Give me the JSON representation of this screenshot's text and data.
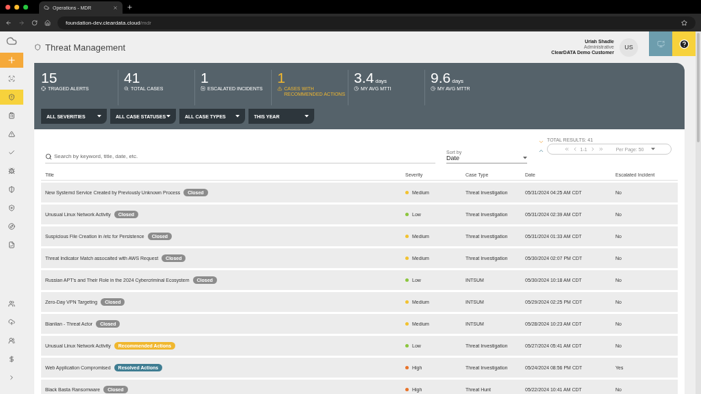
{
  "browser": {
    "tab_title": "Operations - MDR",
    "url_host": "foundation-dev.cleardata.cloud",
    "url_path": "/mdr"
  },
  "header": {
    "title": "Threat Management",
    "user_name": "Uriah Shadle",
    "user_role": "Administrative",
    "user_org": "ClearDATA Demo Customer",
    "avatar": "US"
  },
  "sidebar": {
    "items": [
      {
        "selected": false
      },
      {
        "selected": false
      },
      {
        "selected": true
      },
      {
        "selected": false
      },
      {
        "selected": false
      },
      {
        "selected": false
      },
      {
        "selected": false
      },
      {
        "selected": false
      },
      {
        "selected": false
      },
      {
        "selected": false
      },
      {
        "selected": false
      }
    ]
  },
  "stats": [
    {
      "value": "15",
      "label": "TRIAGED ALERTS",
      "highlight": false
    },
    {
      "value": "41",
      "label": "TOTAL CASES",
      "highlight": false
    },
    {
      "value": "1",
      "label": "ESCALATED INCIDENTS",
      "highlight": false
    },
    {
      "value": "1",
      "label": "CASES WITH RECOMMENDED ACTIONS",
      "highlight": true
    },
    {
      "value": "3.4",
      "unit": "days",
      "label": "MY AVG MTTI",
      "highlight": false
    },
    {
      "value": "9.6",
      "unit": "days",
      "label": "MY AVG MTTR",
      "highlight": false
    }
  ],
  "filters": [
    "ALL SEVERITIES",
    "ALL CASE STATUSES",
    "ALL CASE TYPES",
    "THIS YEAR"
  ],
  "search": {
    "placeholder": "Search by keyword, title, date, etc."
  },
  "sort": {
    "label": "Sort by",
    "value": "Date"
  },
  "pagination": {
    "total": "TOTAL RESULTS: 41",
    "range": "1-1",
    "per_page": "Per Page: 50"
  },
  "table": {
    "columns": [
      "Title",
      "Severity",
      "Case Type",
      "Date",
      "Escalated Incident"
    ],
    "rows": [
      {
        "title": "New Systemd Service Created by Previously Unknown Process",
        "badge": {
          "text": "Closed",
          "color": "#8c8c8c"
        },
        "severity": "Medium",
        "color": "#f2c230",
        "case_type": "Threat Investigation",
        "date": "05/31/2024 04:25 AM CDT",
        "escalated": "No"
      },
      {
        "title": "Unusual Linux Network Activity",
        "badge": {
          "text": "Closed",
          "color": "#8c8c8c"
        },
        "severity": "Low",
        "color": "#8cc63f",
        "case_type": "Threat Investigation",
        "date": "05/31/2024 02:39 AM CDT",
        "escalated": "No"
      },
      {
        "title": "Suspicious File Creation in /etc for Persistence",
        "badge": {
          "text": "Closed",
          "color": "#8c8c8c"
        },
        "severity": "Medium",
        "color": "#f2c230",
        "case_type": "Threat Investigation",
        "date": "05/31/2024 01:33 AM CDT",
        "escalated": "No"
      },
      {
        "title": "Threat Indicator Match assocaited with AWS Request",
        "badge": {
          "text": "Closed",
          "color": "#8c8c8c"
        },
        "severity": "Medium",
        "color": "#f2c230",
        "case_type": "Threat Investigation",
        "date": "05/30/2024 02:07 PM CDT",
        "escalated": "No"
      },
      {
        "title": "Russian APT's and Their Role in the 2024 Cybercriminal Ecosystem",
        "badge": {
          "text": "Closed",
          "color": "#8c8c8c"
        },
        "severity": "Low",
        "color": "#8cc63f",
        "case_type": "INTSUM",
        "date": "05/30/2024 10:18 AM CDT",
        "escalated": "No"
      },
      {
        "title": "Zero-Day VPN Targeting",
        "badge": {
          "text": "Closed",
          "color": "#8c8c8c"
        },
        "severity": "Medium",
        "color": "#f2c230",
        "case_type": "INTSUM",
        "date": "05/29/2024 02:25 PM CDT",
        "escalated": "No"
      },
      {
        "title": "Bianlian - Threat Actor",
        "badge": {
          "text": "Closed",
          "color": "#8c8c8c"
        },
        "severity": "Medium",
        "color": "#f2c230",
        "case_type": "INTSUM",
        "date": "05/28/2024 10:23 AM CDT",
        "escalated": "No"
      },
      {
        "title": "Unusual Linux Network Activity",
        "badge": {
          "text": "Recommended Actions",
          "color": "#f0b72f"
        },
        "severity": "Low",
        "color": "#8cc63f",
        "case_type": "Threat Investigation",
        "date": "05/27/2024 05:41 AM CDT",
        "escalated": "No"
      },
      {
        "title": "Web Application Compromised",
        "badge": {
          "text": "Resolved Actions",
          "color": "#3f7d92"
        },
        "severity": "High",
        "color": "#e8732a",
        "case_type": "Threat Investigation",
        "date": "05/24/2024 08:56 PM CDT",
        "escalated": "Yes"
      },
      {
        "title": "Black Basta Ransomware",
        "badge": {
          "text": "Closed",
          "color": "#8c8c8c"
        },
        "severity": "High",
        "color": "#e8732a",
        "case_type": "Threat Hunt",
        "date": "05/22/2024 10:41 AM CDT",
        "escalated": "No"
      }
    ]
  }
}
